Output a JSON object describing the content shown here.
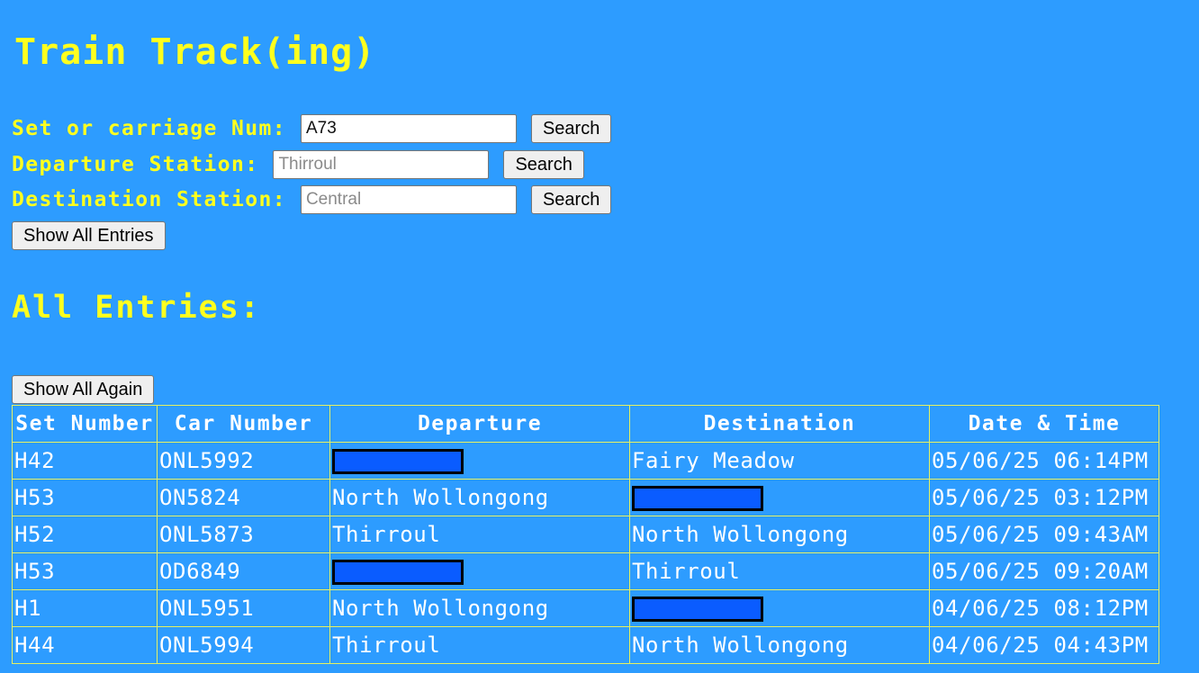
{
  "app": {
    "title": "Train Track(ing)"
  },
  "search": {
    "set_label": "Set or carriage Num:",
    "set_value": "A73",
    "set_button": "Search",
    "departure_label": "Departure Station:",
    "departure_placeholder": "Thirroul",
    "departure_button": "Search",
    "destination_label": "Destination Station:",
    "destination_placeholder": "Central",
    "destination_button": "Search",
    "show_all_button": "Show All Entries"
  },
  "entries": {
    "heading": "All Entries:",
    "show_again_button": "Show All Again",
    "columns": [
      "Set Number",
      "Car Number",
      "Departure",
      "Destination",
      "Date & Time"
    ],
    "rows": [
      {
        "set": "H42",
        "car": "ONL5992",
        "departure": "",
        "departure_redacted": true,
        "destination": "Fairy Meadow",
        "destination_redacted": false,
        "datetime": "05/06/25 06:14PM"
      },
      {
        "set": "H53",
        "car": "ON5824",
        "departure": "North Wollongong",
        "departure_redacted": false,
        "destination": "",
        "destination_redacted": true,
        "datetime": "05/06/25 03:12PM"
      },
      {
        "set": "H52",
        "car": "ONL5873",
        "departure": "Thirroul",
        "departure_redacted": false,
        "destination": "North Wollongong",
        "destination_redacted": false,
        "datetime": "05/06/25 09:43AM"
      },
      {
        "set": "H53",
        "car": "OD6849",
        "departure": "",
        "departure_redacted": true,
        "destination": "Thirroul",
        "destination_redacted": false,
        "datetime": "05/06/25 09:20AM"
      },
      {
        "set": "H1",
        "car": "ONL5951",
        "departure": "North Wollongong",
        "departure_redacted": false,
        "destination": "",
        "destination_redacted": true,
        "datetime": "04/06/25 08:12PM"
      },
      {
        "set": "H44",
        "car": "ONL5994",
        "departure": "Thirroul",
        "departure_redacted": false,
        "destination": "North Wollongong",
        "destination_redacted": false,
        "datetime": "04/06/25 04:43PM"
      }
    ]
  },
  "colors": {
    "background": "#2d9cff",
    "heading_text": "#ffff1e",
    "table_text": "#ffffff",
    "redaction_fill": "#0a5cff"
  }
}
